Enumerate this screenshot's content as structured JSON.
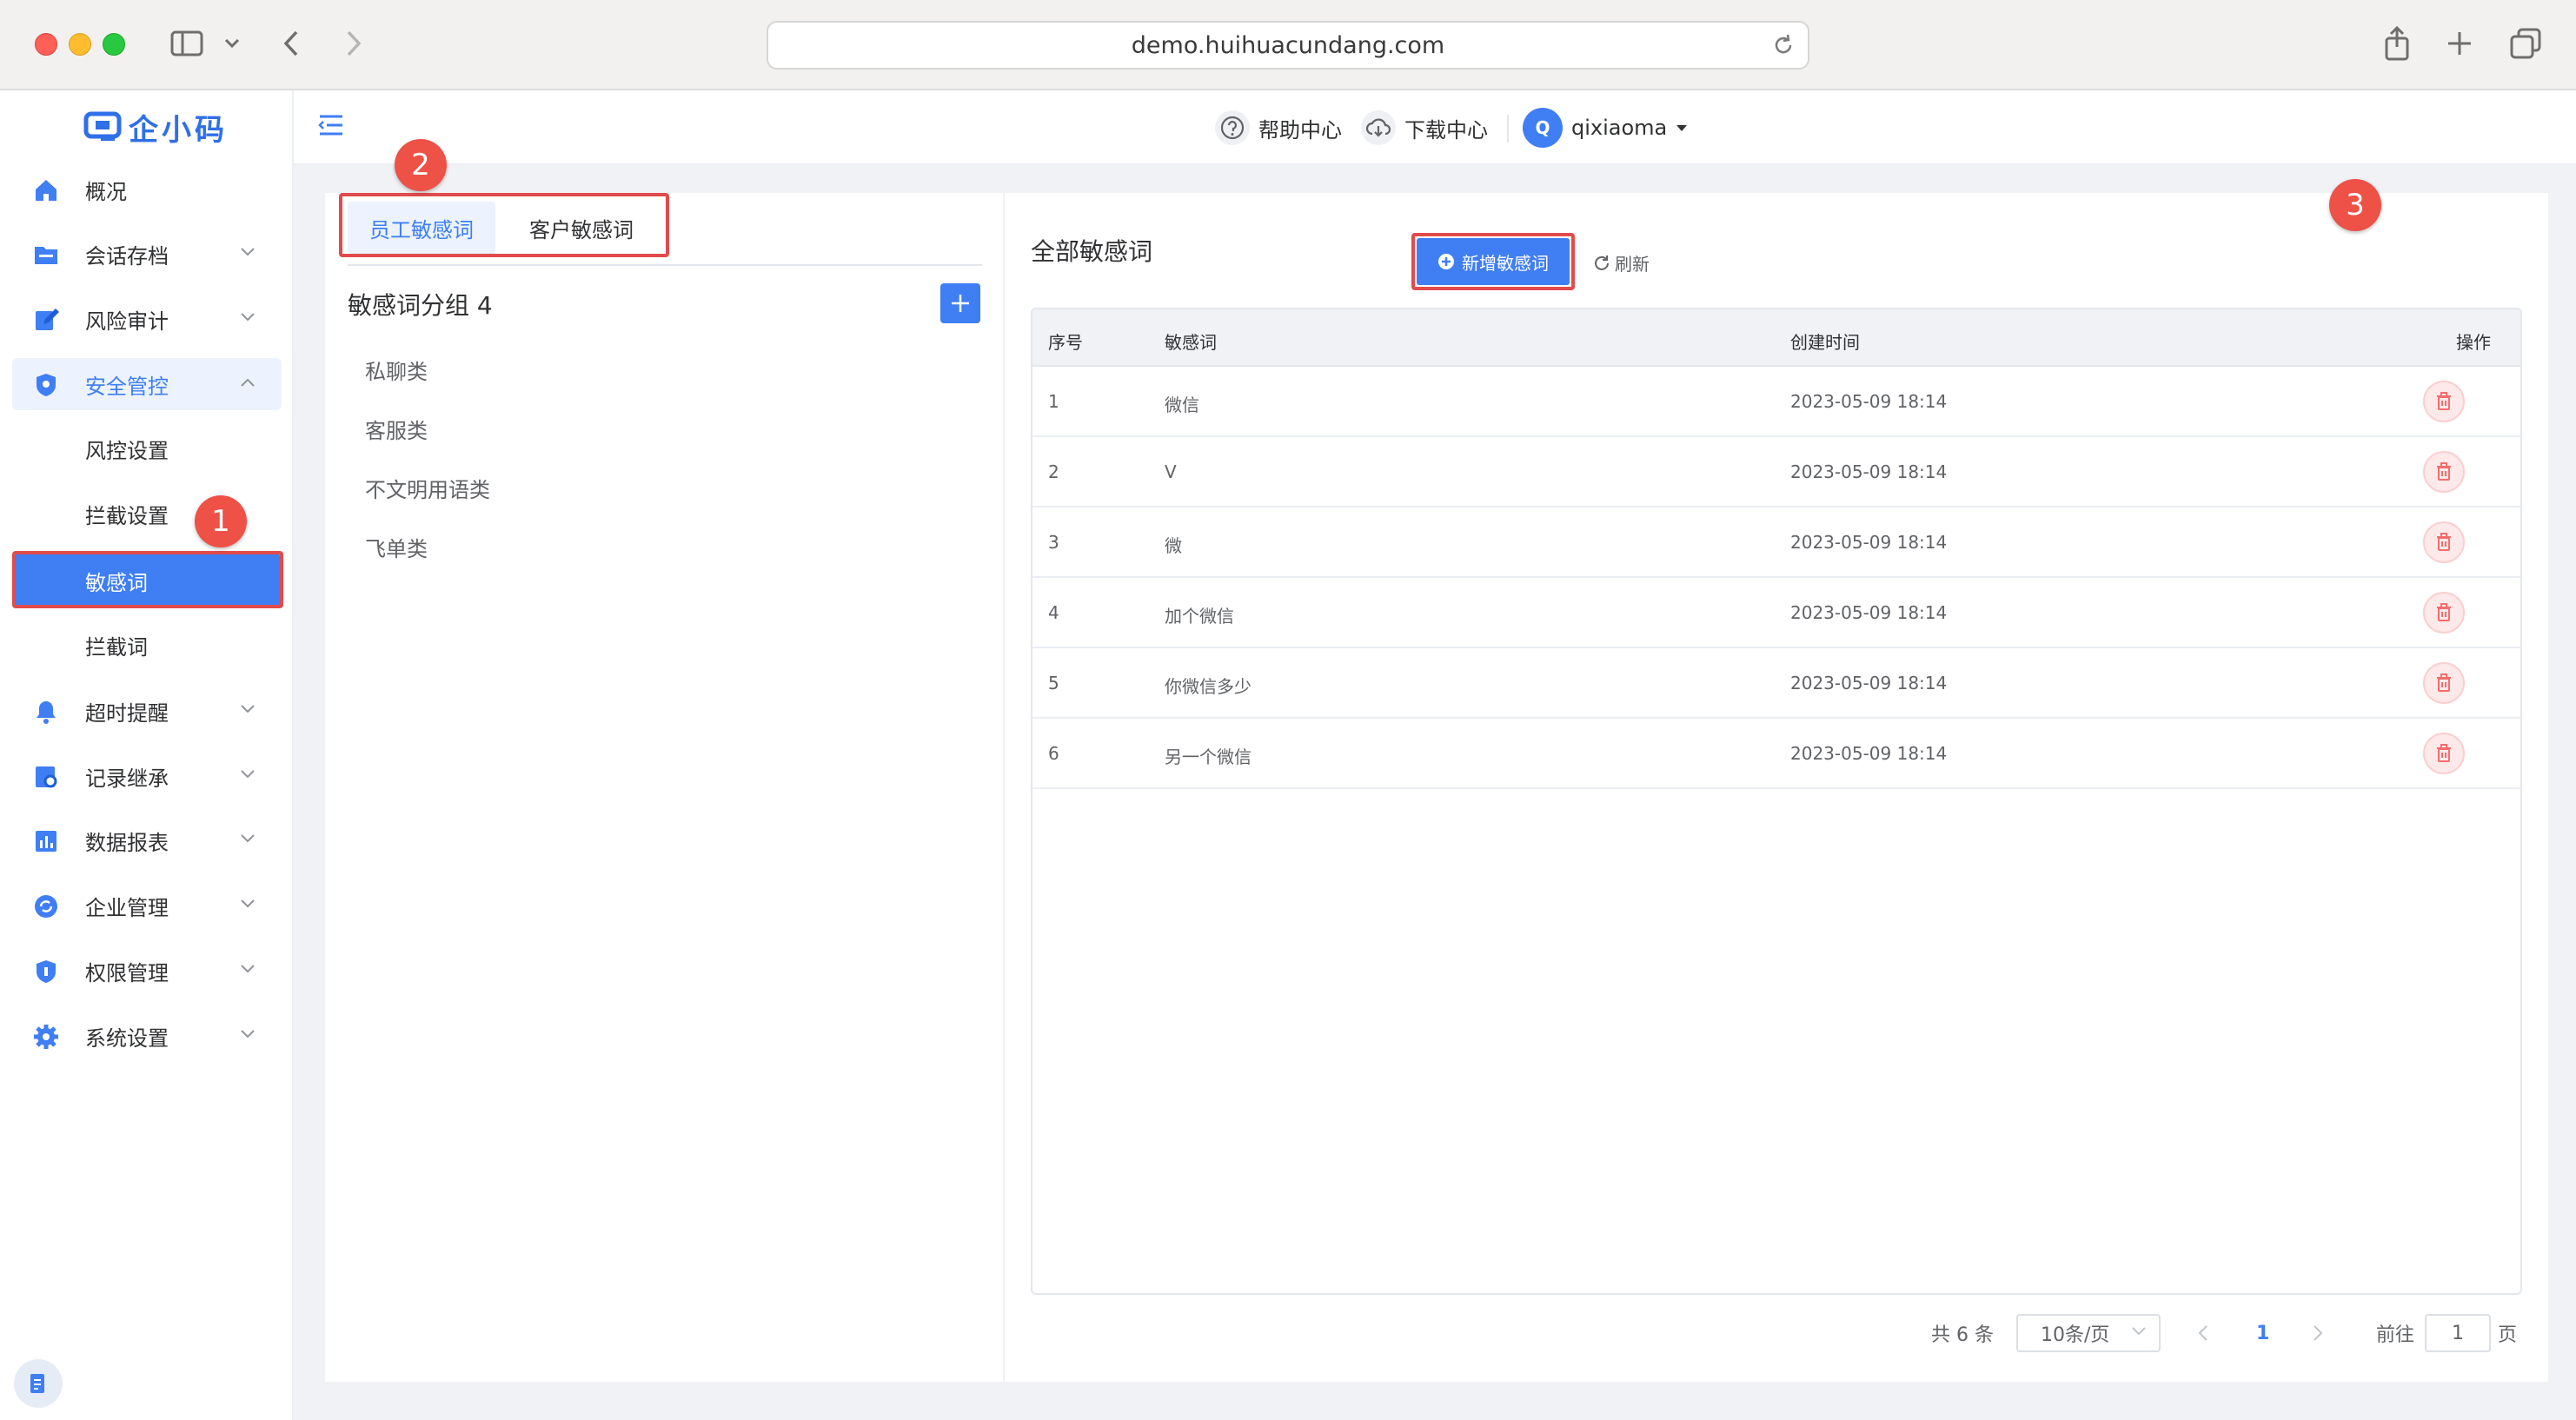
{
  "browser": {
    "url": "demo.huihuacundang.com"
  },
  "logo": {
    "text": "企小码"
  },
  "sidebar": {
    "items": [
      {
        "label": "概况"
      },
      {
        "label": "会话存档"
      },
      {
        "label": "风险审计"
      },
      {
        "label": "安全管控"
      },
      {
        "label": "风控设置"
      },
      {
        "label": "拦截设置"
      },
      {
        "label": "敏感词"
      },
      {
        "label": "拦截词"
      },
      {
        "label": "超时提醒"
      },
      {
        "label": "记录继承"
      },
      {
        "label": "数据报表"
      },
      {
        "label": "企业管理"
      },
      {
        "label": "权限管理"
      },
      {
        "label": "系统设置"
      }
    ]
  },
  "header": {
    "help": "帮助中心",
    "download": "下载中心",
    "avatar_initial": "Q",
    "username": "qixiaoma"
  },
  "annotations": {
    "one": "1",
    "two": "2",
    "three": "3"
  },
  "tabs": [
    {
      "label": "员工敏感词"
    },
    {
      "label": "客户敏感词"
    }
  ],
  "groups": {
    "title": "敏感词分组 4",
    "items": [
      {
        "label": "私聊类"
      },
      {
        "label": "客服类"
      },
      {
        "label": "不文明用语类"
      },
      {
        "label": "飞单类"
      }
    ]
  },
  "main": {
    "title": "全部敏感词",
    "add_button": "新增敏感词",
    "refresh": "刷新"
  },
  "table": {
    "columns": [
      "序号",
      "敏感词",
      "创建时间",
      "操作"
    ],
    "rows": [
      {
        "no": "1",
        "word": "微信",
        "time": "2023-05-09 18:14"
      },
      {
        "no": "2",
        "word": "V",
        "time": "2023-05-09 18:14"
      },
      {
        "no": "3",
        "word": "微",
        "time": "2023-05-09 18:14"
      },
      {
        "no": "4",
        "word": "加个微信",
        "time": "2023-05-09 18:14"
      },
      {
        "no": "5",
        "word": "你微信多少",
        "time": "2023-05-09 18:14"
      },
      {
        "no": "6",
        "word": "另一个微信",
        "time": "2023-05-09 18:14"
      }
    ]
  },
  "pagination": {
    "total": "共 6 条",
    "page_size": "10条/页",
    "current": "1",
    "goto_prefix": "前往",
    "goto_value": "1",
    "goto_suffix": "页"
  },
  "colors": {
    "accent": "#3f7ef3",
    "annotation": "#ee5146",
    "danger": "#f56c6c"
  }
}
